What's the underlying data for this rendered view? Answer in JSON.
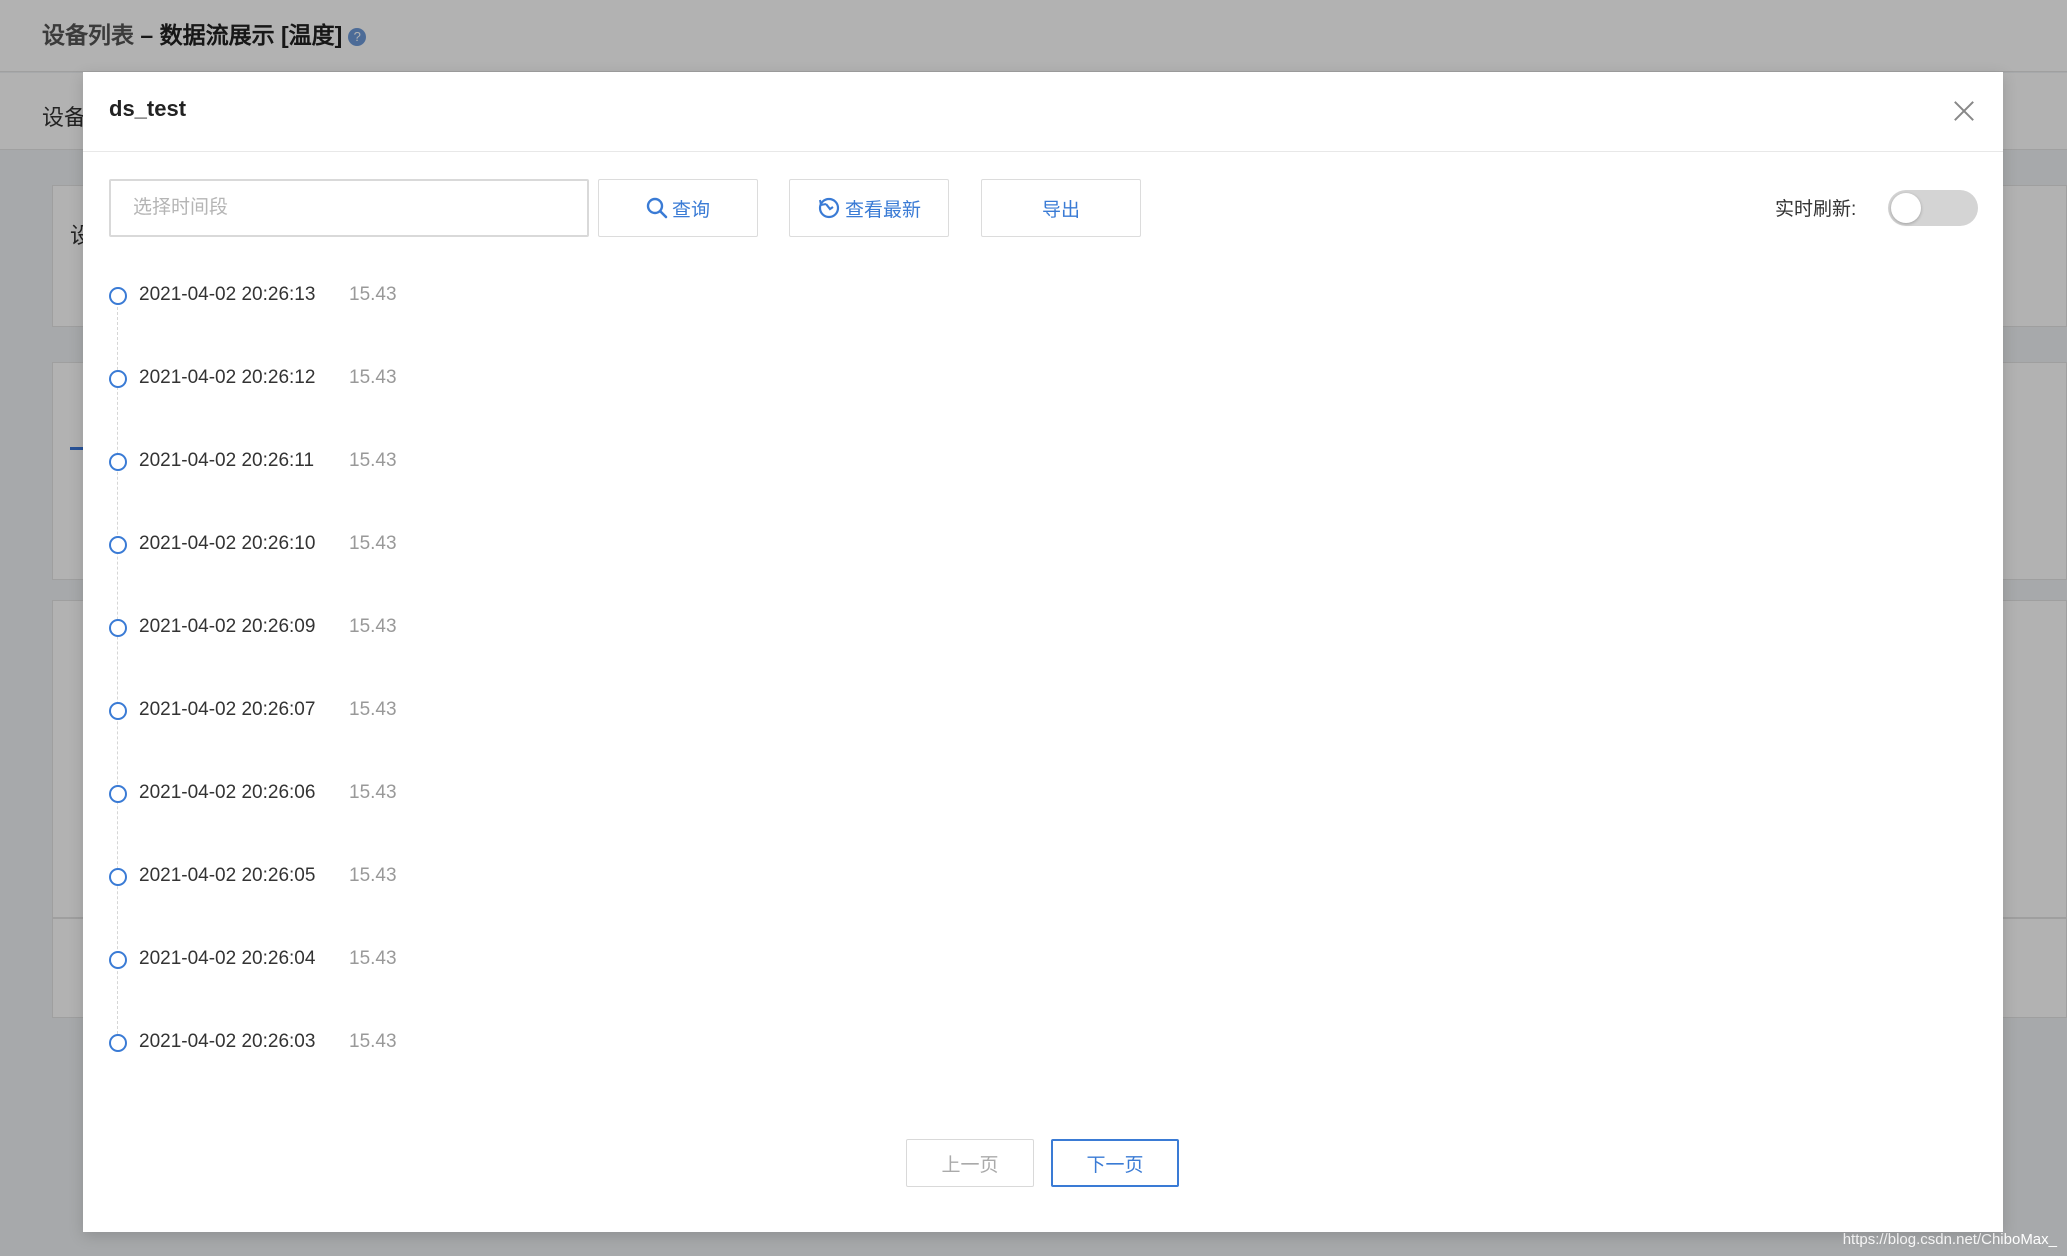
{
  "background": {
    "breadcrumb_parent": "设备列表",
    "breadcrumb_separator": " – ",
    "breadcrumb_current": "数据流展示 [温度]",
    "help_icon": "?",
    "subbar_label": "设备",
    "card_label": "设",
    "watermark": "https://blog.csdn.net/ChiboMax_"
  },
  "modal": {
    "title": "ds_test",
    "date_range_placeholder": "选择时间段",
    "query_label": "查询",
    "view_latest_label": "查看最新",
    "export_label": "导出",
    "realtime_label": "实时刷新:",
    "realtime_enabled": false,
    "records": [
      {
        "time": "2021-04-02 20:26:13",
        "value": "15.43"
      },
      {
        "time": "2021-04-02 20:26:12",
        "value": "15.43"
      },
      {
        "time": "2021-04-02 20:26:11",
        "value": "15.43"
      },
      {
        "time": "2021-04-02 20:26:10",
        "value": "15.43"
      },
      {
        "time": "2021-04-02 20:26:09",
        "value": "15.43"
      },
      {
        "time": "2021-04-02 20:26:07",
        "value": "15.43"
      },
      {
        "time": "2021-04-02 20:26:06",
        "value": "15.43"
      },
      {
        "time": "2021-04-02 20:26:05",
        "value": "15.43"
      },
      {
        "time": "2021-04-02 20:26:04",
        "value": "15.43"
      },
      {
        "time": "2021-04-02 20:26:03",
        "value": "15.43"
      }
    ],
    "prev_page_label": "上一页",
    "next_page_label": "下一页"
  },
  "colors": {
    "accent": "#3a7bd5",
    "mask": "rgba(0,0,0,0.30)",
    "toggle_off": "#d4d4d4"
  }
}
